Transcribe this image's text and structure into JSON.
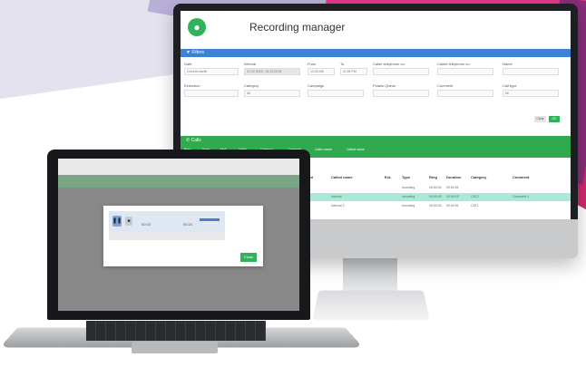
{
  "colors": {
    "accent_green": "#31aa4f",
    "accent_blue": "#3c82d6",
    "bg_pink": "#e83a8a",
    "bg_purple": "#b9b0d8"
  },
  "monitor": {
    "logo_icon": "microphone-icon",
    "title": "Recording manager",
    "filters": {
      "label": "Filters",
      "fields": [
        "Date",
        "Interval",
        "From",
        "To",
        "Caller telephone no.",
        "Called telephone no.",
        "Name",
        "Extension",
        "Category",
        "Campaign",
        "Polaris Queue",
        "Comment",
        "Call type"
      ],
      "date_value": "Current month",
      "interval_value": "01.12.2015 - 31.12.2015",
      "from_value": "12:00 AM",
      "to_value": "11:59 PM",
      "category_value": "All",
      "calltype_value": "All",
      "clear_label": "Clear",
      "ok_label": "OK"
    },
    "calls": {
      "label": "Calls",
      "toolbar": [
        "Play",
        "Save",
        "Mail",
        "Verify",
        "Category",
        "Comment",
        "Caller name",
        "Called name"
      ],
      "columns": [
        "Called",
        "Called name",
        "Ext.",
        "Type",
        "Ring",
        "Duration",
        "Category",
        "Comment"
      ],
      "rows": [
        [
          "30",
          "",
          "",
          "Incoming",
          "00:00:03",
          "00:00:51",
          "",
          ""
        ],
        [
          "30",
          "Internal",
          "",
          "Incoming",
          "00:00:03",
          "00:00:15",
          "CAT2",
          "Comment 1"
        ],
        [
          "30",
          "Internal 2",
          "",
          "Incoming",
          "00:00:03",
          "00:00:51",
          "CAT1",
          ""
        ]
      ]
    }
  },
  "laptop": {
    "player": {
      "time_current": "00:03",
      "time_total": "00:24",
      "play_icon": "pause-icon",
      "stop_icon": "stop-icon",
      "volume_icon": "volume-icon"
    },
    "close_label": "Close"
  }
}
